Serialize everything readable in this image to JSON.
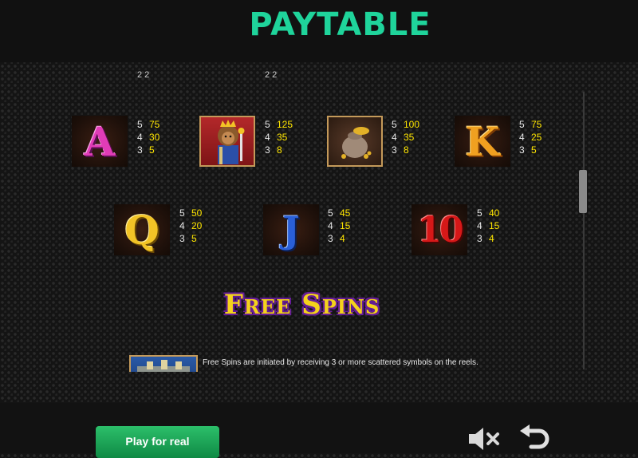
{
  "header": {
    "title": "PAYTABLE"
  },
  "top_partial_pays": [
    {
      "text": "2  2"
    },
    {
      "text": "2  2"
    }
  ],
  "symbols_row1": [
    {
      "id": "A",
      "glyph": "A",
      "pays": [
        {
          "count": "5",
          "value": "75"
        },
        {
          "count": "4",
          "value": "30"
        },
        {
          "count": "3",
          "value": "5"
        }
      ]
    },
    {
      "id": "king",
      "glyph": "",
      "icon": "lion-king-icon",
      "pays": [
        {
          "count": "5",
          "value": "125"
        },
        {
          "count": "4",
          "value": "35"
        },
        {
          "count": "3",
          "value": "8"
        }
      ]
    },
    {
      "id": "gold-bag",
      "glyph": "",
      "icon": "gold-bag-icon",
      "pays": [
        {
          "count": "5",
          "value": "100"
        },
        {
          "count": "4",
          "value": "35"
        },
        {
          "count": "3",
          "value": "8"
        }
      ]
    },
    {
      "id": "K",
      "glyph": "K",
      "pays": [
        {
          "count": "5",
          "value": "75"
        },
        {
          "count": "4",
          "value": "25"
        },
        {
          "count": "3",
          "value": "5"
        }
      ]
    }
  ],
  "symbols_row2": [
    {
      "id": "Q",
      "glyph": "Q",
      "pays": [
        {
          "count": "5",
          "value": "50"
        },
        {
          "count": "4",
          "value": "20"
        },
        {
          "count": "3",
          "value": "5"
        }
      ]
    },
    {
      "id": "J",
      "glyph": "J",
      "pays": [
        {
          "count": "5",
          "value": "45"
        },
        {
          "count": "4",
          "value": "15"
        },
        {
          "count": "3",
          "value": "4"
        }
      ]
    },
    {
      "id": "10",
      "glyph": "10",
      "pays": [
        {
          "count": "5",
          "value": "40"
        },
        {
          "count": "4",
          "value": "15"
        },
        {
          "count": "3",
          "value": "4"
        }
      ]
    }
  ],
  "free_spins": {
    "title": "Free Spins",
    "description": "Free Spins are initiated by receiving 3 or more scattered symbols on the reels."
  },
  "footer": {
    "play_label": "Play for real",
    "mute_icon": "speaker-muted-icon",
    "back_icon": "back-arrow-icon"
  },
  "colors": {
    "title": "#1fd49b",
    "pay_value": "#ffe600",
    "play_button": "#1faa5a"
  }
}
